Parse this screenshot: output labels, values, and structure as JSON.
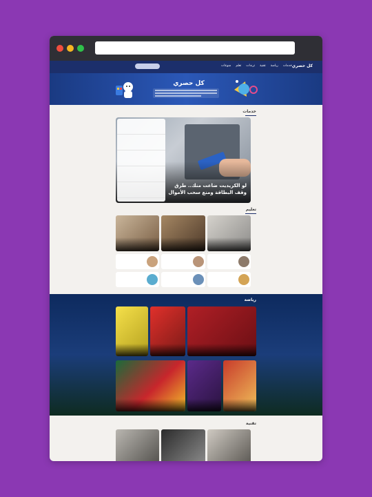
{
  "browser": {
    "url": ""
  },
  "site": {
    "logo": "كل حصري"
  },
  "nav": {
    "items": [
      "خدمات",
      "رياضة",
      "تقنية",
      "ترندات",
      "تعلم",
      "منوعات"
    ]
  },
  "hero": {
    "title": "كل حصري"
  },
  "sections": {
    "services": "خدمات",
    "education": "تعليم",
    "sports": "رياضة",
    "tech": "تقنية"
  },
  "feature": {
    "title": "لو الكريديت ضاعت منك.. طرق وقف البطاقة ومنع سحب الأموال",
    "list": [
      "",
      "",
      "",
      "",
      "",
      ""
    ]
  },
  "education": {
    "cards": [
      "",
      "",
      ""
    ],
    "minis": [
      "",
      "",
      "",
      "",
      "",
      ""
    ]
  },
  "sports": {
    "cards": [
      "",
      "",
      "",
      "",
      "",
      "",
      ""
    ]
  },
  "colors": {
    "nav": "#1c2f6b",
    "accent": "#2b58b8",
    "bg": "#f3f1ee",
    "frame": "#8b38b3"
  }
}
